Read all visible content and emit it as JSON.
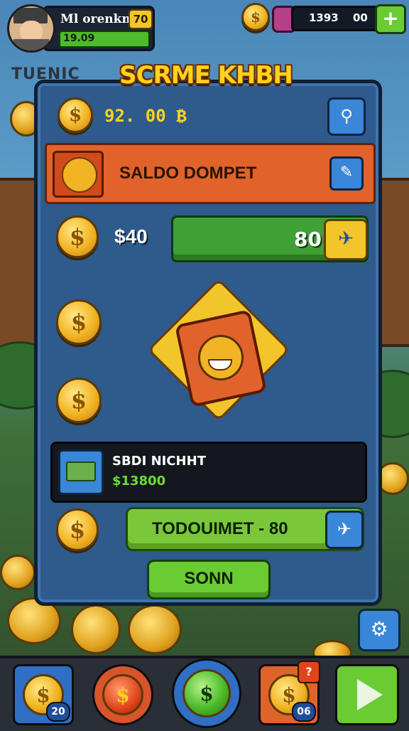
{
  "hud": {
    "player_name": "Ml orenkn",
    "level": "70",
    "xp": "19.09",
    "currency_value": "1393",
    "currency_sub": "00",
    "add_symbol": "+"
  },
  "background_sign": "TUENIC",
  "title": "SCRME KHBH",
  "panel": {
    "balance": "92. 00 ₿",
    "wallet_title": "SALDO  DOMPET",
    "price": "$40",
    "progress_value": "80",
    "item_name": "SBDI NICHHT",
    "item_amount": "$13800",
    "action_label": "TODOUIMET - 80",
    "confirm_label": "SONN"
  },
  "icons": {
    "coin_symbol": "$",
    "pin": "⚲",
    "edit": "✎",
    "send": "✈",
    "settings": "⚙"
  },
  "bottom_nav": {
    "wallet_badge": "20",
    "bonus_alert": "?",
    "bonus_badge": "06"
  },
  "colors": {
    "panel": "#2e5a8c",
    "accent_orange": "#e0632b",
    "accent_green": "#6bcb33",
    "gold": "#f2b425",
    "blue_button": "#3a86d8"
  }
}
